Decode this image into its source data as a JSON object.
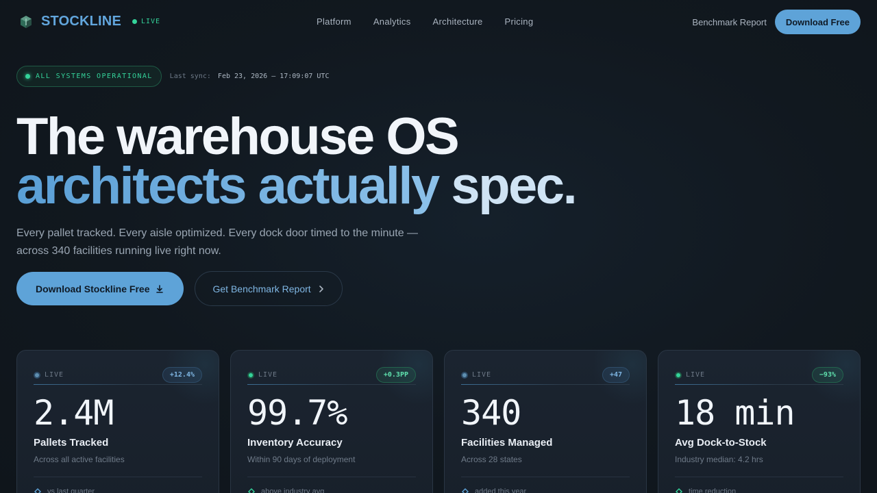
{
  "nav": {
    "brand": "STOCKLINE",
    "live_label": "LIVE",
    "links": [
      "Platform",
      "Analytics",
      "Architecture",
      "Pricing"
    ],
    "report_link": "Benchmark Report",
    "download_button": "Download Free"
  },
  "status": {
    "pill": "ALL SYSTEMS OPERATIONAL",
    "sync_label": "Last sync:",
    "sync_value": "Feb 23, 2026 — 17:09:07 UTC"
  },
  "hero": {
    "line1": "The warehouse OS",
    "line2a": "architects actually ",
    "line2b": "spec.",
    "subtitle": "Every pallet tracked. Every aisle optimized. Every dock door timed to the minute — across 340 facilities running live right now.",
    "cta_primary": "Download Stockline Free",
    "cta_secondary": "Get Benchmark Report"
  },
  "cards": [
    {
      "live": "LIVE",
      "badge": "+12.4%",
      "value": "2.4M",
      "label": "Pallets Tracked",
      "desc": "Across all active facilities",
      "foot": "vs last quarter",
      "accent": "#5ea3d8"
    },
    {
      "live": "LIVE",
      "badge": "+0.3PP",
      "value": "99.7%",
      "label": "Inventory Accuracy",
      "desc": "Within 90 days of deployment",
      "foot": "above industry avg",
      "accent": "#34d39a"
    },
    {
      "live": "LIVE",
      "badge": "+47",
      "value": "340",
      "label": "Facilities Managed",
      "desc": "Across 28 states",
      "foot": "added this year",
      "accent": "#5ea3d8"
    },
    {
      "live": "LIVE",
      "badge": "−93%",
      "value": "18 min",
      "label": "Avg Dock-to-Stock",
      "desc": "Industry median: 4.2 hrs",
      "foot": "time reduction",
      "accent": "#34d39a"
    }
  ],
  "colors": {
    "accent_blue": "#5ea3d8",
    "accent_green": "#34d39a",
    "background": "#11181f"
  }
}
